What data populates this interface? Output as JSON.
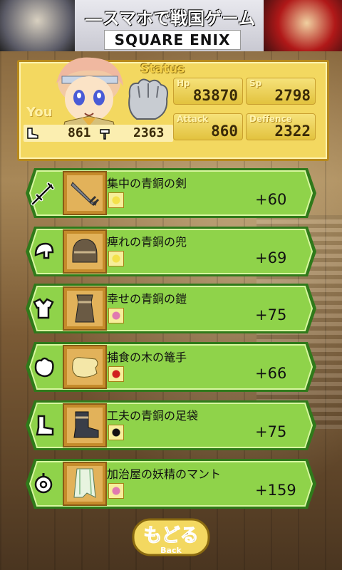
{
  "banner": {
    "title": "―スマホで戦国ゲーム―",
    "brand": "SQUARE ENIX"
  },
  "status": {
    "title": "Status",
    "you_label": "You",
    "hp_label": "Hp",
    "hp": "83870",
    "sp_label": "Sp",
    "sp": "2798",
    "attack_label": "Attack",
    "attack": "860",
    "defence_label": "Deffence",
    "defence": "2322",
    "stat_a": "861",
    "stat_b": "2363"
  },
  "equipment": [
    {
      "slot": "sword-icon",
      "name": "集中の青銅の剣",
      "bonus": "+60",
      "gem_color": "#f3e14a"
    },
    {
      "slot": "helmet-icon",
      "name": "痺れの青銅の兜",
      "bonus": "+69",
      "gem_color": "#f3e14a"
    },
    {
      "slot": "armor-icon",
      "name": "幸せの青銅の鎧",
      "bonus": "+75",
      "gem_color": "#e07ab0"
    },
    {
      "slot": "gauntlet-icon",
      "name": "捕食の木の篭手",
      "bonus": "+66",
      "gem_color": "#d0201e"
    },
    {
      "slot": "boots-icon",
      "name": "工夫の青銅の足袋",
      "bonus": "+75",
      "gem_color": "#111111"
    },
    {
      "slot": "cape-icon",
      "name": "加治屋の妖精のマント",
      "bonus": "+159",
      "gem_color": "#e07ab0"
    }
  ],
  "back": {
    "label": "もどる",
    "sub": "Back"
  },
  "colors": {
    "row_green": "#8fd34a",
    "row_dark": "#2f7a1a",
    "panel_gold": "#f3d860"
  }
}
